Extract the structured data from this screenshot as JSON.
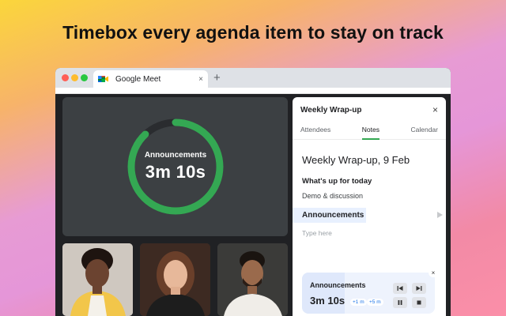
{
  "headline": "Timebox every agenda item to stay on track",
  "browser": {
    "tab_title": "Google Meet",
    "tab_close": "×",
    "new_tab": "+"
  },
  "stage": {
    "label": "Announcements",
    "time": "3m 10s",
    "progress": 0.88,
    "ring_color": "#34a853",
    "track_color": "#2a2c2f"
  },
  "panel": {
    "title": "Weekly Wrap-up",
    "close": "×",
    "tabs": [
      {
        "label": "Attendees",
        "active": false
      },
      {
        "label": "Notes",
        "active": true
      },
      {
        "label": "Calendar",
        "active": false
      }
    ],
    "notes_title": "Weekly Wrap-up, 9 Feb",
    "heading": "What's up for today",
    "item": "Demo & discussion",
    "agenda_item": "Announcements",
    "agenda_progress": 0.48,
    "placeholder": "Type here"
  },
  "timer": {
    "label": "Announcements",
    "time": "3m 10s",
    "chip_add_1": "+1 m",
    "chip_add_5": "+5 m",
    "progress": 0.32,
    "close": "×"
  },
  "colors": {
    "accent": "#34a853",
    "chip_text": "#1a73e8"
  }
}
